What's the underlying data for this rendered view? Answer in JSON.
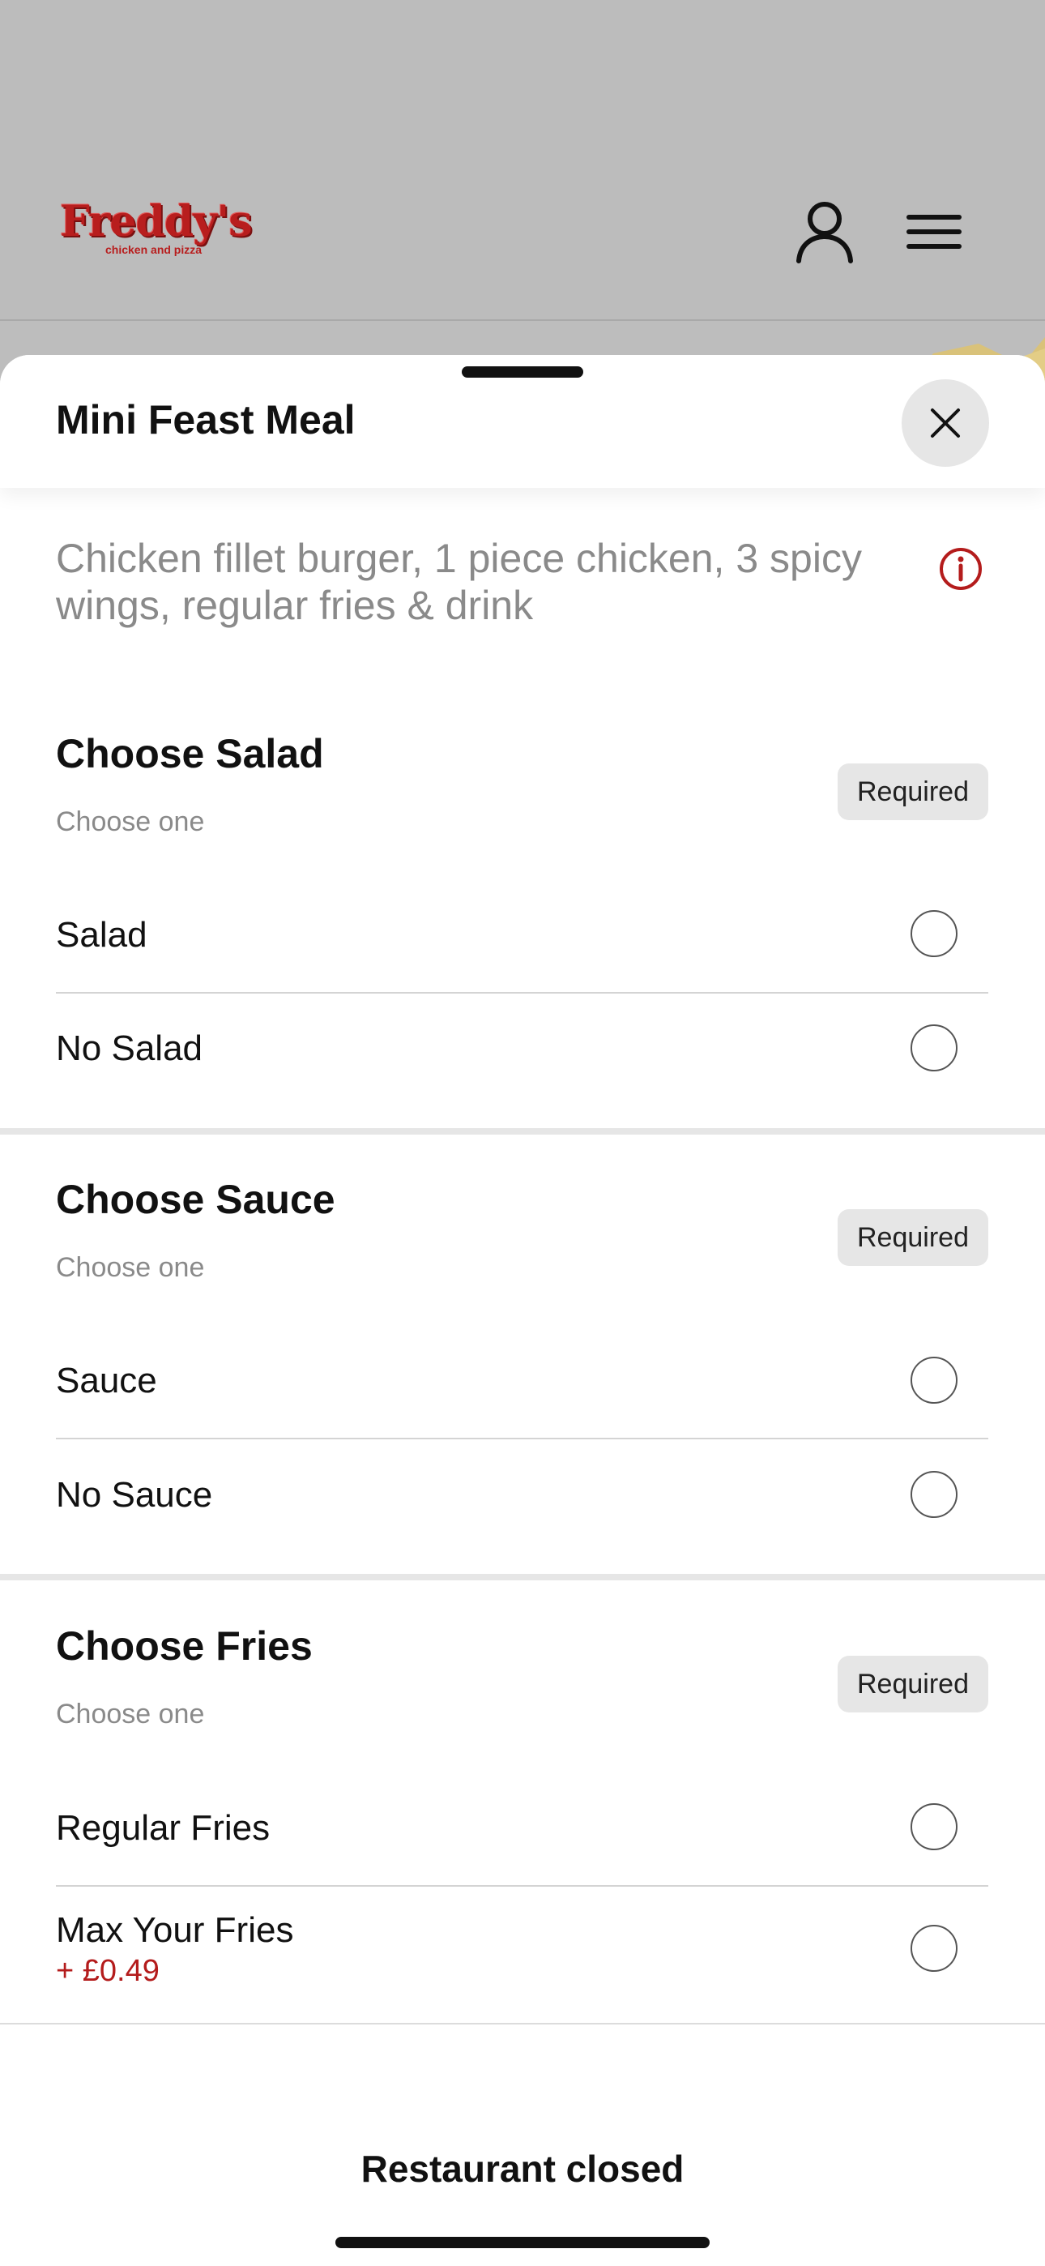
{
  "header": {
    "logo_text": "Freddy's",
    "logo_subtext": "chicken and pizza",
    "brand_color": "#b81e1e",
    "icons": [
      "user-icon",
      "menu-icon"
    ]
  },
  "sheet": {
    "title": "Mini Feast Meal",
    "close_icon": "close-icon",
    "description": "Chicken fillet burger, 1 piece chicken, 3 spicy wings, regular fries & drink",
    "info_icon": "info-icon",
    "accent_color": "#b41c1c"
  },
  "groups": [
    {
      "title": "Choose Salad",
      "subtitle": "Choose one",
      "badge": "Required",
      "options": [
        {
          "label": "Salad",
          "price": ""
        },
        {
          "label": "No Salad",
          "price": ""
        }
      ]
    },
    {
      "title": "Choose Sauce",
      "subtitle": "Choose one",
      "badge": "Required",
      "options": [
        {
          "label": "Sauce",
          "price": ""
        },
        {
          "label": "No Sauce",
          "price": ""
        }
      ]
    },
    {
      "title": "Choose  Fries",
      "subtitle": "Choose one",
      "badge": "Required",
      "options": [
        {
          "label": "Regular Fries",
          "price": ""
        },
        {
          "label": "Max Your Fries",
          "price": "+ £0.49"
        }
      ]
    }
  ],
  "footer": {
    "status_label": "Restaurant closed"
  }
}
